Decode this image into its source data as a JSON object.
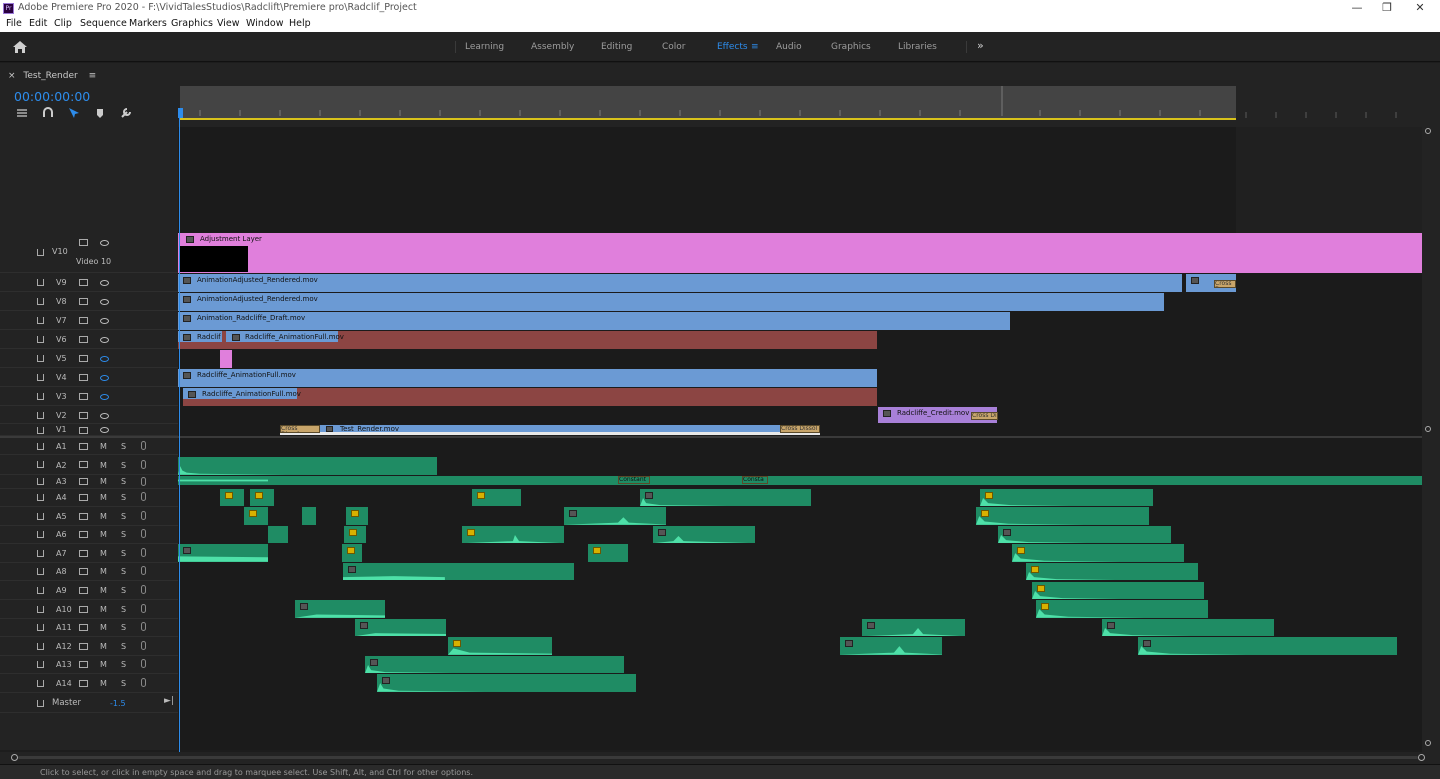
{
  "window": {
    "title": "Adobe Premiere Pro 2020 - F:\\VividTalesStudios\\Radclift\\Premiere pro\\Radclif_Project",
    "app_icon": "Pr"
  },
  "menu": [
    "File",
    "Edit",
    "Clip",
    "Sequence",
    "Markers",
    "Graphics",
    "View",
    "Window",
    "Help"
  ],
  "workspaces": {
    "items": [
      "Learning",
      "Assembly",
      "Editing",
      "Color",
      "Effects",
      "Audio",
      "Graphics",
      "Libraries"
    ],
    "active": "Effects",
    "more_glyph": "»"
  },
  "sequence": {
    "tab_name": "Test_Render",
    "tab_menu_glyph": "≡",
    "timecode": "00:00:00:00"
  },
  "video_tracks": [
    {
      "id": "V10",
      "name": "Video 10",
      "eye": "on"
    },
    {
      "id": "V9",
      "eye": "on"
    },
    {
      "id": "V8",
      "eye": "on"
    },
    {
      "id": "V7",
      "eye": "on"
    },
    {
      "id": "V6",
      "eye": "on"
    },
    {
      "id": "V5",
      "eye": "off"
    },
    {
      "id": "V4",
      "eye": "off"
    },
    {
      "id": "V3",
      "eye": "off"
    },
    {
      "id": "V2",
      "eye": "on"
    },
    {
      "id": "V1",
      "eye": "on"
    }
  ],
  "audio_tracks": [
    "A1",
    "A2",
    "A3",
    "A4",
    "A5",
    "A6",
    "A7",
    "A8",
    "A9",
    "A10",
    "A11",
    "A12",
    "A13",
    "A14"
  ],
  "audio_buttons": {
    "mute": "M",
    "solo": "S"
  },
  "master": {
    "label": "Master",
    "value": "-1.5"
  },
  "clips": {
    "adjustment": "Adjustment Layer",
    "v9": "AnimationAdjusted_Rendered.mov",
    "v9_trans": "Cross D",
    "v8": "AnimationAdjusted_Rendered.mov",
    "v7": "Animation_Radcliffe_Draft.mov",
    "v6a": "Radclif",
    "v6b": "Radcliffe_AnimationFull.mov",
    "v4": "Radcliffe_AnimationFull.mov",
    "v3": "Radcliffe_AnimationFull.mov",
    "v2": "Radcliffe_Credit.mov",
    "v2_trans": "Cross Di",
    "v1": "Test_Render.mov",
    "v1_trans_a": "Cross Dissolv",
    "v1_trans_b": "Cross Dissol",
    "a3_trans_a": "Constant",
    "a3_trans_b": "Consta"
  },
  "status_text": "Click to select, or click in empty space and drag to marquee select. Use Shift, Alt, and Ctrl for other options.",
  "colors": {
    "accent": "#2d8ceb",
    "video_blue": "#6b9ad4",
    "video_red": "#8c4543",
    "adjustment_pink": "#e07fdc",
    "credit_purple": "#a880d8",
    "audio_green": "#1f8c64",
    "work_area": "#d8c21b"
  }
}
